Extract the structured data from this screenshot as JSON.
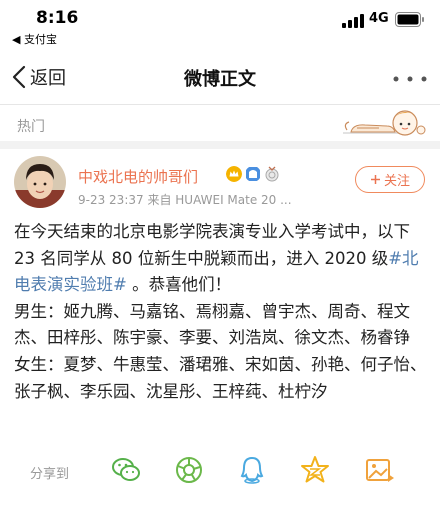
{
  "status_bar": {
    "time": "8:16",
    "back_app": "◀ 支付宝",
    "network": "4G"
  },
  "nav": {
    "back_label": "返回",
    "title": "微博正文"
  },
  "section": {
    "label": "热门"
  },
  "post": {
    "user_name": "中戏北电的帅哥们",
    "meta": "9-23 23:37  来自 HUAWEI Mate 20 ...",
    "follow_label": "关注",
    "intro_a": "在今天结束的北京电影学院表演专业入学考试中，以下 23 名同学从 80 位新生中脱颖而出，进入 2020 级",
    "hashtag": "#北电表演实验班#",
    "intro_b": " 。恭喜他们！",
    "male_line": "男生：姬九腾、马嘉铭、焉栩嘉、曾宇杰、周奇、程文杰、田梓彤、陈宇豪、李要、刘浩岚、徐文杰、杨睿铮",
    "female_line": "女生：夏梦、牛惠莹、潘珺雅、宋如茵、孙艳、何子怡、张子枫、李乐园、沈星彤、王梓莼、杜柠汐"
  },
  "share": {
    "label": "分享到"
  },
  "colors": {
    "accent": "#eb7350",
    "link": "#507daf",
    "muted": "#999999"
  },
  "icons": [
    "chevron-left-icon",
    "more-icon",
    "plus-icon",
    "wechat-icon",
    "moments-icon",
    "qq-icon",
    "qzone-icon",
    "image-share-icon"
  ]
}
